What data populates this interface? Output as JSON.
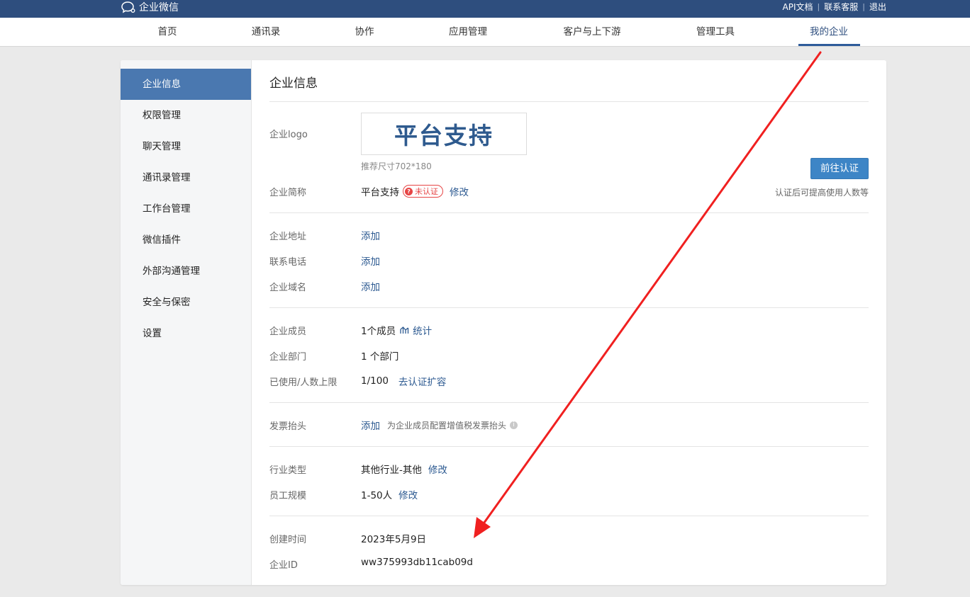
{
  "topbar": {
    "brand": "企业微信",
    "links": [
      "API文档",
      "联系客服",
      "退出"
    ]
  },
  "nav": {
    "items": [
      "首页",
      "通讯录",
      "协作",
      "应用管理",
      "客户与上下游",
      "管理工具",
      "我的企业"
    ],
    "active": "我的企业"
  },
  "sidebar": {
    "items": [
      "企业信息",
      "权限管理",
      "聊天管理",
      "通讯录管理",
      "工作台管理",
      "微信插件",
      "外部沟通管理",
      "安全与保密",
      "设置"
    ],
    "active": "企业信息"
  },
  "main": {
    "title": "企业信息",
    "logo": {
      "label": "企业logo",
      "text": "平台支持",
      "hint": "推荐尺寸702*180"
    },
    "short_name": {
      "label": "企业简称",
      "value": "平台支持",
      "badge": "未认证",
      "edit": "修改"
    },
    "certify": {
      "button": "前往认证",
      "hint": "认证后可提高使用人数等"
    },
    "address": {
      "label": "企业地址",
      "action": "添加"
    },
    "phone": {
      "label": "联系电话",
      "action": "添加"
    },
    "domain": {
      "label": "企业域名",
      "action": "添加"
    },
    "members": {
      "label": "企业成员",
      "value": "1个成员",
      "stats": "统计"
    },
    "departments": {
      "label": "企业部门",
      "value": "1 个部门"
    },
    "usage": {
      "label": "已使用/人数上限",
      "value": "1/100",
      "action": "去认证扩容"
    },
    "invoice": {
      "label": "发票抬头",
      "action": "添加",
      "hint": "为企业成员配置增值税发票抬头"
    },
    "industry": {
      "label": "行业类型",
      "value": "其他行业-其他",
      "edit": "修改"
    },
    "scale": {
      "label": "员工规模",
      "value": "1-50人",
      "edit": "修改"
    },
    "created": {
      "label": "创建时间",
      "value": "2023年5月9日"
    },
    "corp_id": {
      "label": "企业ID",
      "value": "ww375993db11cab09d"
    }
  },
  "colors": {
    "topbar": "#2e4e7e",
    "accent": "#4a78b0",
    "link": "#2d5a91",
    "warning": "#e64545",
    "annotation_arrow": "#f02020"
  }
}
